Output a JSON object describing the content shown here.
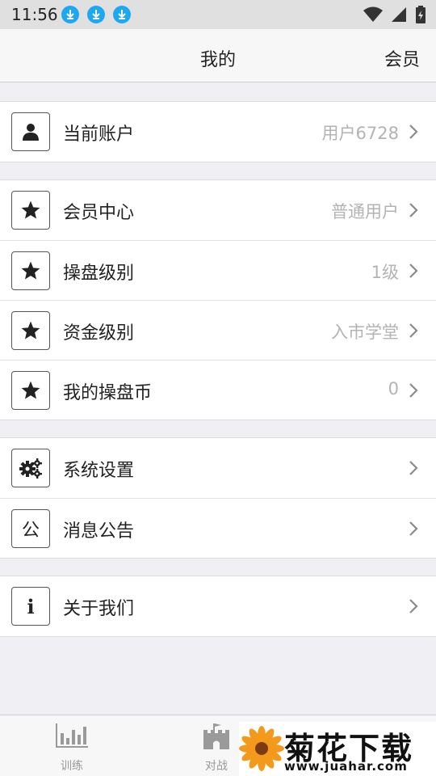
{
  "status_bar": {
    "time": "11:56"
  },
  "nav": {
    "title": "我的",
    "member_button": "会员"
  },
  "groups": [
    {
      "items": [
        {
          "label": "当前账户",
          "value": "用户6728",
          "icon": "user-icon"
        }
      ]
    },
    {
      "items": [
        {
          "label": "会员中心",
          "value": "普通用户",
          "icon": "star-icon"
        },
        {
          "label": "操盘级别",
          "value": "1级",
          "icon": "star-icon"
        },
        {
          "label": "资金级别",
          "value": "入市学堂",
          "icon": "star-icon"
        },
        {
          "label": "我的操盘币",
          "value": "0",
          "icon": "star-icon"
        }
      ]
    },
    {
      "items": [
        {
          "label": "系统设置",
          "value": "",
          "icon": "gears-icon"
        },
        {
          "label": "消息公告",
          "value": "",
          "icon": "notice-icon",
          "icon_char": "公"
        }
      ]
    },
    {
      "items": [
        {
          "label": "关于我们",
          "value": "",
          "icon": "info-icon",
          "icon_char": "i"
        }
      ]
    }
  ],
  "tabs": [
    {
      "label": "训练",
      "icon": "bar-chart-icon"
    },
    {
      "label": "对战",
      "icon": "castle-icon"
    }
  ],
  "watermark": {
    "title": "菊花下载网",
    "url": "www.juahar.com",
    "icon": "flower-icon"
  },
  "colors": {
    "download_badge": "#1ea8f0",
    "value_text": "#b3b3b3",
    "tab_inactive": "#999999"
  }
}
